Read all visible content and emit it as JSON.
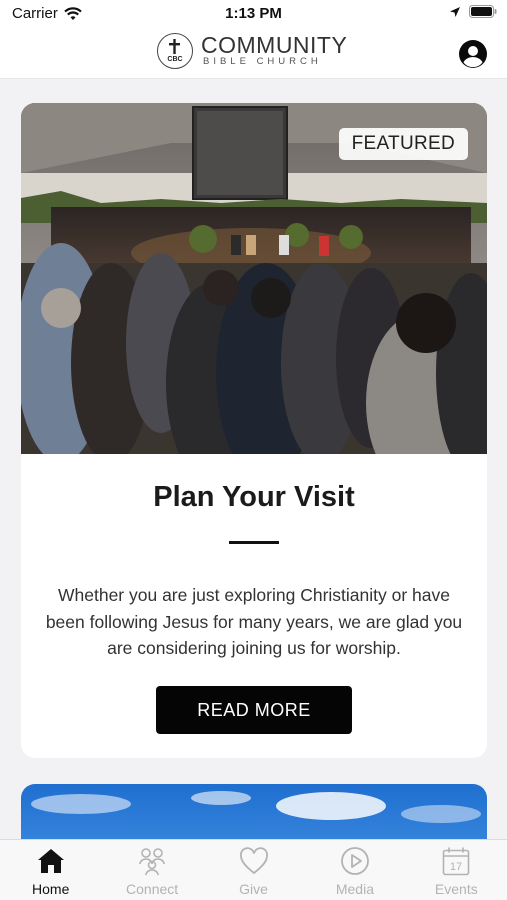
{
  "status_bar": {
    "carrier": "Carrier",
    "time": "1:13 PM"
  },
  "header": {
    "logo_badge": "CBC",
    "logo_title": "COMMUNITY",
    "logo_subtitle": "BIBLE CHURCH",
    "profile_icon": "user-circle-icon"
  },
  "featured_card": {
    "badge": "FEATURED",
    "title": "Plan Your Visit",
    "description": "Whether you are just exploring Christianity or have been following Jesus for many years, we are glad you are considering joining us for worship.",
    "button_label": "READ MORE"
  },
  "tab_bar": {
    "tabs": [
      {
        "label": "Home",
        "icon": "home-icon",
        "active": true
      },
      {
        "label": "Connect",
        "icon": "people-icon",
        "active": false
      },
      {
        "label": "Give",
        "icon": "heart-icon",
        "active": false
      },
      {
        "label": "Media",
        "icon": "play-circle-icon",
        "active": false
      },
      {
        "label": "Events",
        "icon": "calendar-icon",
        "active": false
      }
    ],
    "events_date": "17"
  },
  "colors": {
    "active_tab": "#111111",
    "inactive_tab": "#b3b3b3",
    "button_bg": "#050505"
  }
}
